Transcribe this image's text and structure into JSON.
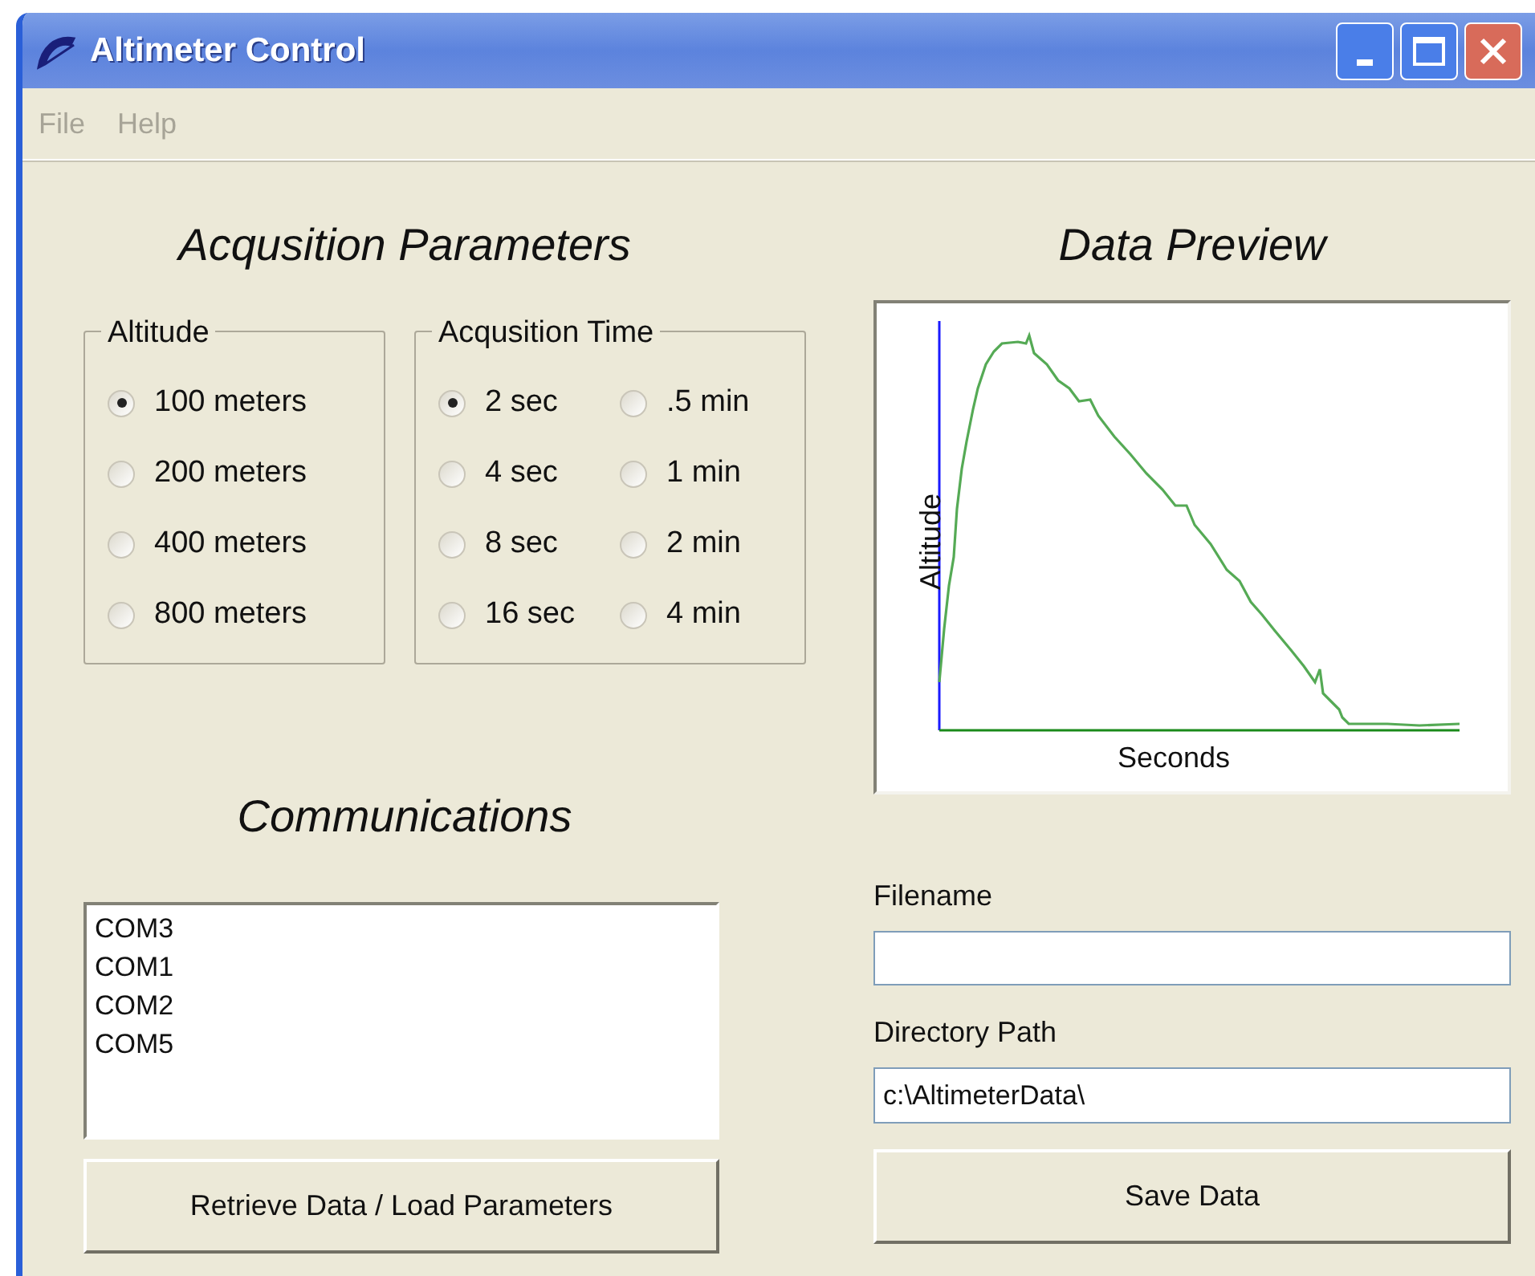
{
  "window": {
    "title": "Altimeter Control"
  },
  "menu": [
    "File",
    "Help"
  ],
  "acquisition": {
    "heading": "Acqusition Parameters",
    "altitude": {
      "title": "Altitude",
      "options": [
        {
          "label": "100 meters",
          "selected": true
        },
        {
          "label": "200 meters",
          "selected": false
        },
        {
          "label": "400 meters",
          "selected": false
        },
        {
          "label": "800 meters",
          "selected": false
        }
      ]
    },
    "time": {
      "title": "Acqusition Time",
      "options": [
        {
          "label": "2 sec",
          "selected": true
        },
        {
          "label": ".5 min",
          "selected": false
        },
        {
          "label": "4 sec",
          "selected": false
        },
        {
          "label": "1 min",
          "selected": false
        },
        {
          "label": "8 sec",
          "selected": false
        },
        {
          "label": "2 min",
          "selected": false
        },
        {
          "label": "16 sec",
          "selected": false
        },
        {
          "label": "4 min",
          "selected": false
        }
      ]
    }
  },
  "communications": {
    "heading": "Communications",
    "ports": [
      "COM3",
      "COM1",
      "COM2",
      "COM5"
    ],
    "button": "Retrieve Data / Load Parameters"
  },
  "preview": {
    "heading": "Data Preview",
    "xlabel": "Seconds",
    "ylabel": "Altitude"
  },
  "filename": {
    "label": "Filename"
  },
  "directory": {
    "label": "Directory Path",
    "value": "c:\\AltimeterData\\"
  },
  "save_button": "Save Data"
}
